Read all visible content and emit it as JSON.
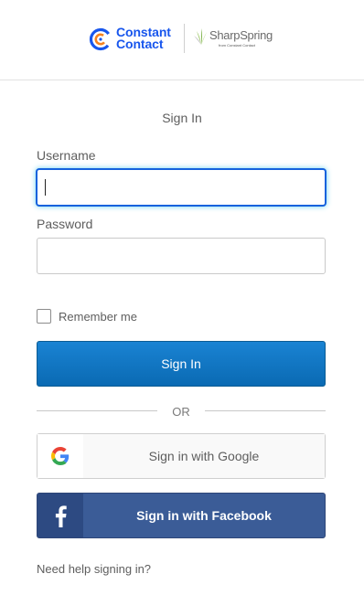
{
  "header": {
    "brand_primary": "Constant Contact",
    "brand_primary_line1": "Constant",
    "brand_primary_line2": "Contact",
    "brand_secondary": "SharpSpring",
    "brand_secondary_sub": "from Constant Contact",
    "brand_color": "#1856ed"
  },
  "form": {
    "title": "Sign In",
    "username_label": "Username",
    "username_value": "",
    "password_label": "Password",
    "password_value": "",
    "remember_label": "Remember me",
    "remember_checked": false,
    "submit_label": "Sign In",
    "submit_color": "#0f74c1"
  },
  "divider": {
    "text": "OR"
  },
  "social": {
    "google_label": "Sign in with Google",
    "google_icon": "google-g-icon",
    "facebook_label": "Sign in with Facebook",
    "facebook_icon": "facebook-f-icon",
    "facebook_color": "#3b5c97"
  },
  "help": {
    "link_text": "Need help signing in?"
  }
}
